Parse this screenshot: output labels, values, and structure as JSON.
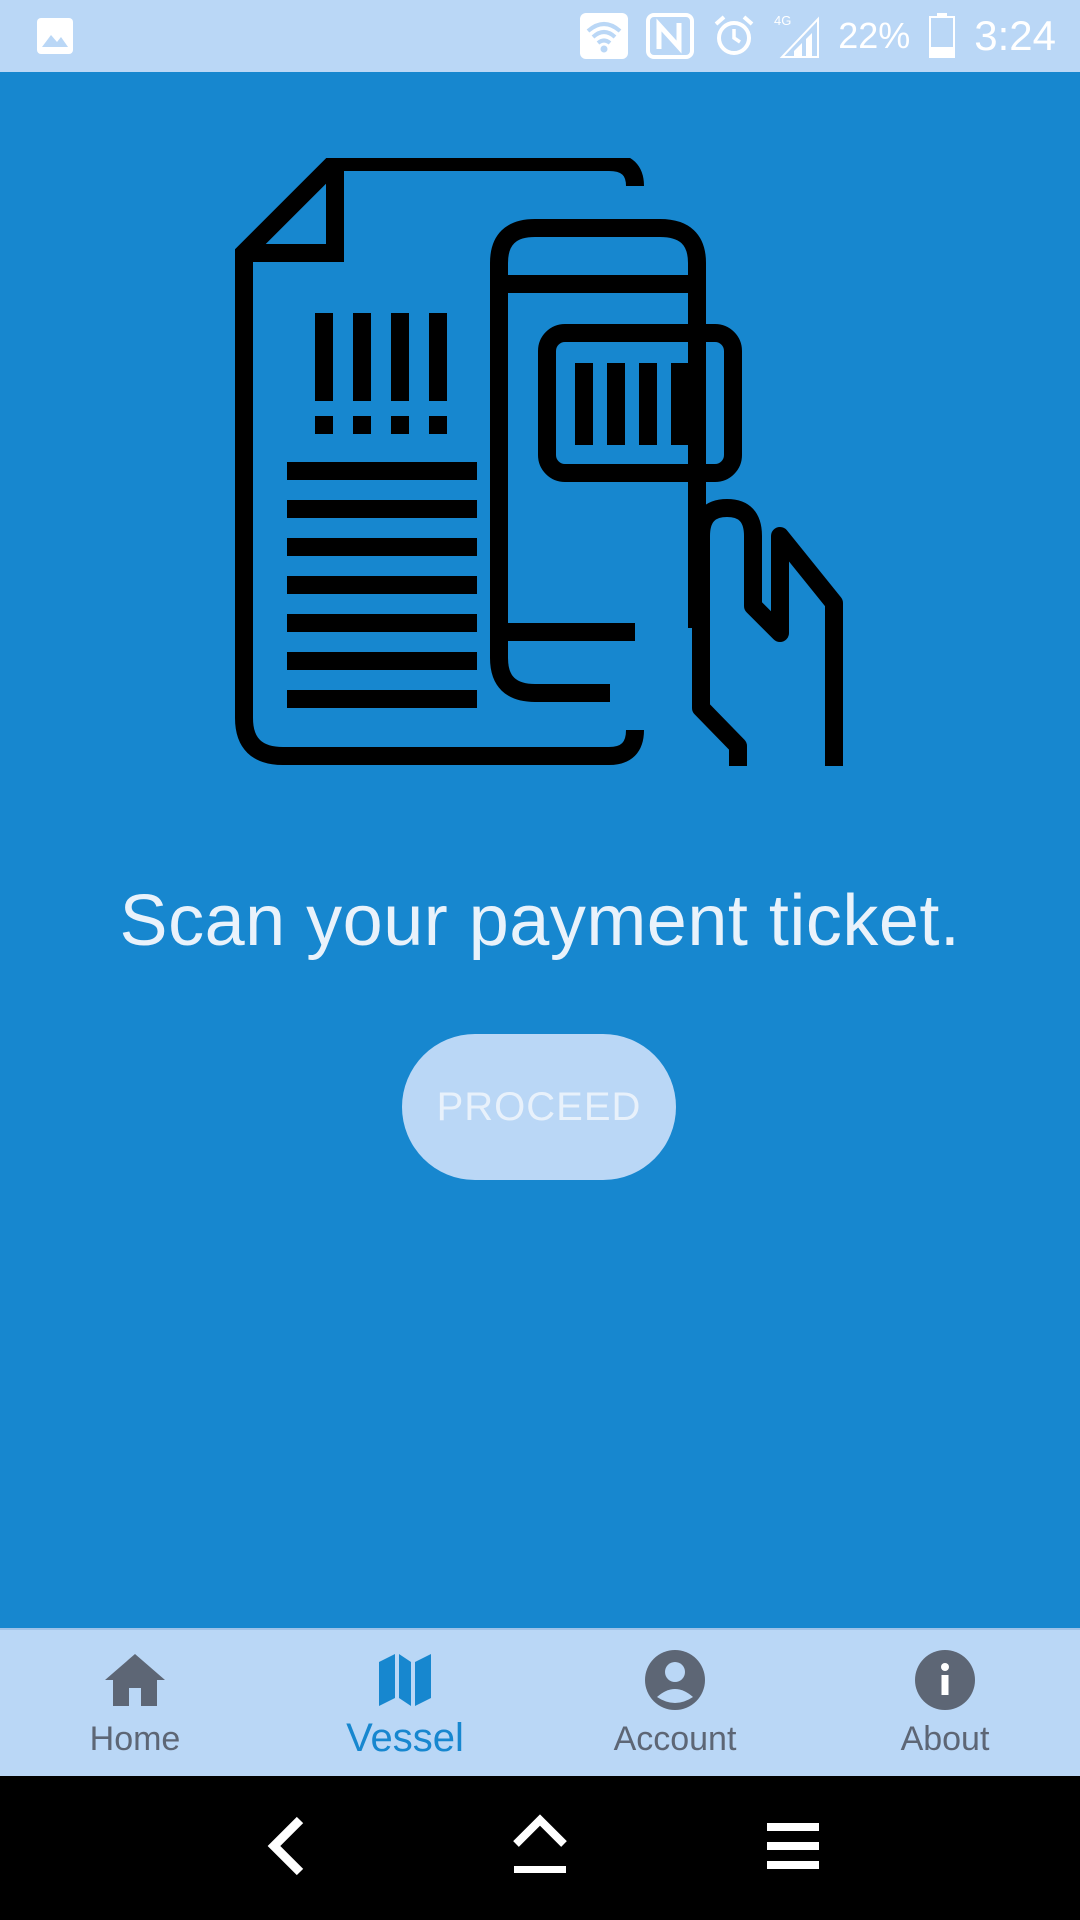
{
  "status_bar": {
    "battery_percent": "22%",
    "time": "3:24",
    "network": "4G",
    "icons": [
      "gallery-icon",
      "wifi-icon",
      "nfc-icon",
      "alarm-icon",
      "signal-icon",
      "battery-icon"
    ]
  },
  "main": {
    "illustration_icon": "ticket-scan-icon",
    "headline": "Scan your payment ticket.",
    "proceed_label": "PROCEED"
  },
  "bottom_nav": {
    "items": [
      {
        "label": "Home",
        "icon": "home-icon",
        "active": false
      },
      {
        "label": "Vessel",
        "icon": "map-icon",
        "active": true
      },
      {
        "label": "Account",
        "icon": "account-icon",
        "active": false
      },
      {
        "label": "About",
        "icon": "info-icon",
        "active": false
      }
    ]
  },
  "colors": {
    "background": "#1787cf",
    "bars": "#bad7f6",
    "active": "#1787cf",
    "inactive": "#5d6675"
  }
}
